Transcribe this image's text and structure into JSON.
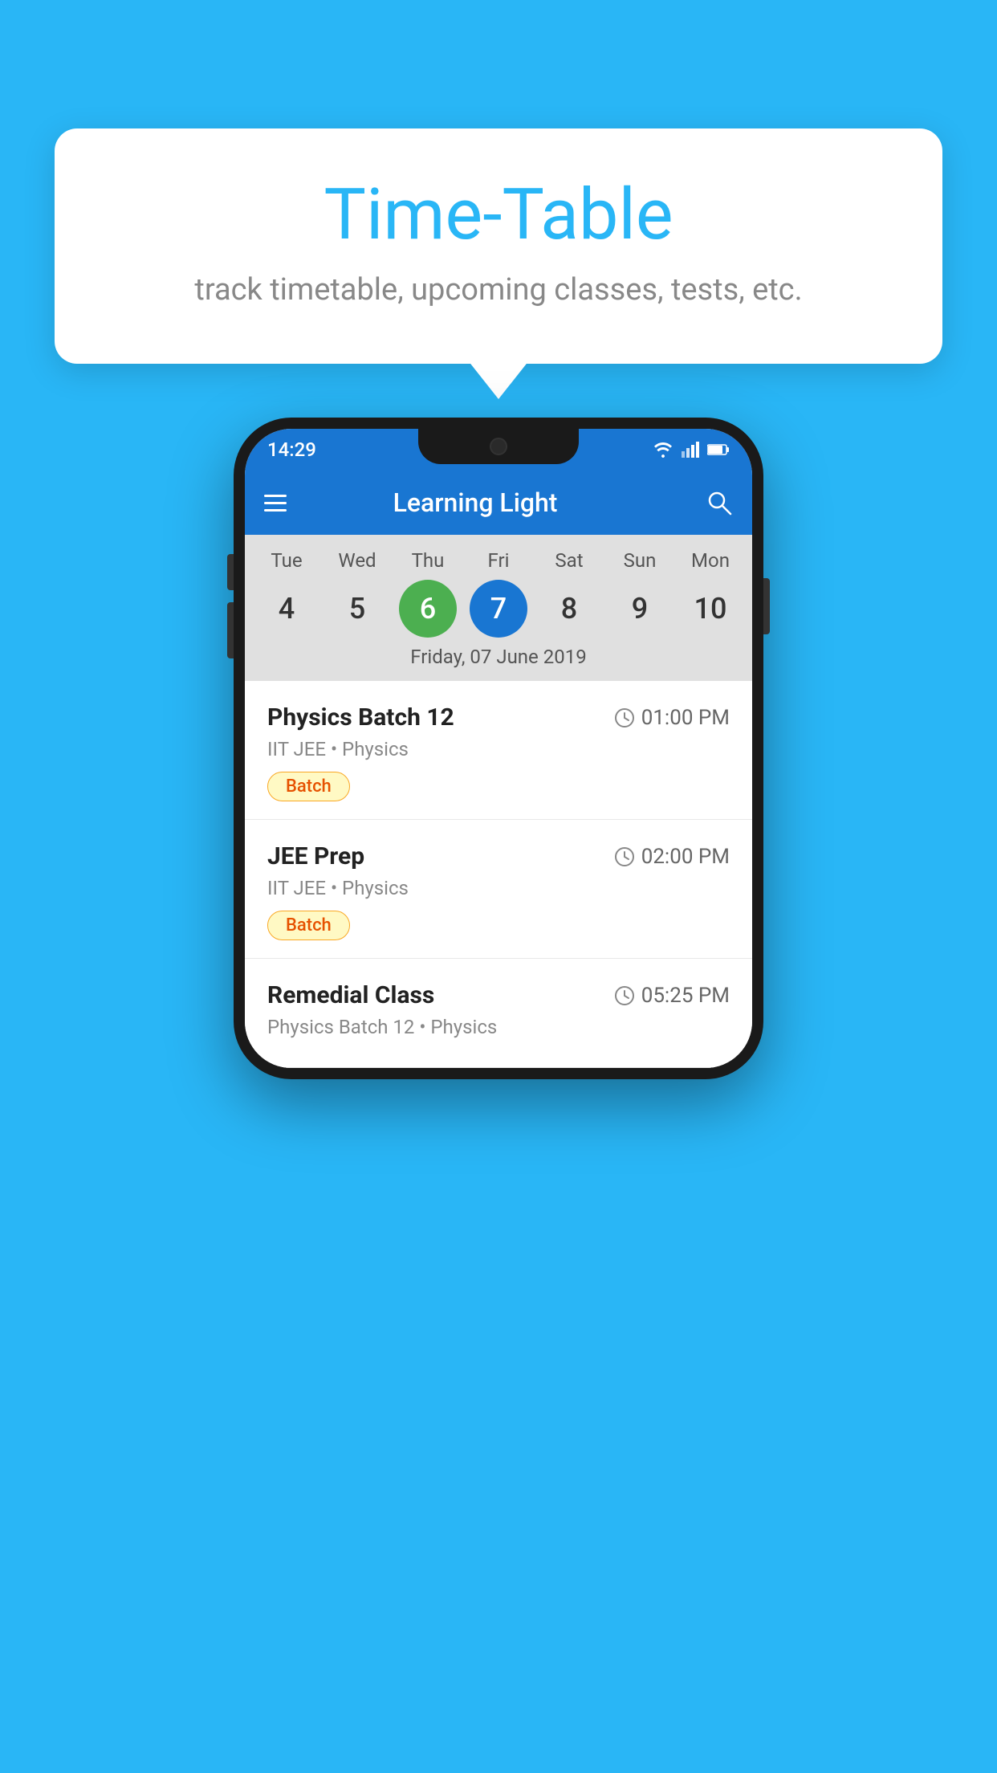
{
  "background_color": "#29B6F6",
  "tooltip": {
    "title": "Time-Table",
    "subtitle": "track timetable, upcoming classes, tests, etc."
  },
  "phone": {
    "status_bar": {
      "time": "14:29"
    },
    "app_bar": {
      "title": "Learning Light"
    },
    "calendar": {
      "days": [
        {
          "label": "Tue",
          "number": "4"
        },
        {
          "label": "Wed",
          "number": "5"
        },
        {
          "label": "Thu",
          "number": "6",
          "state": "today"
        },
        {
          "label": "Fri",
          "number": "7",
          "state": "selected"
        },
        {
          "label": "Sat",
          "number": "8"
        },
        {
          "label": "Sun",
          "number": "9"
        },
        {
          "label": "Mon",
          "number": "10"
        }
      ],
      "selected_date_label": "Friday, 07 June 2019"
    },
    "classes": [
      {
        "name": "Physics Batch 12",
        "time": "01:00 PM",
        "subject_line": "IIT JEE • Physics",
        "badge": "Batch"
      },
      {
        "name": "JEE Prep",
        "time": "02:00 PM",
        "subject_line": "IIT JEE • Physics",
        "badge": "Batch"
      },
      {
        "name": "Remedial Class",
        "time": "05:25 PM",
        "subject_line": "Physics Batch 12 • Physics",
        "badge": null
      }
    ]
  }
}
